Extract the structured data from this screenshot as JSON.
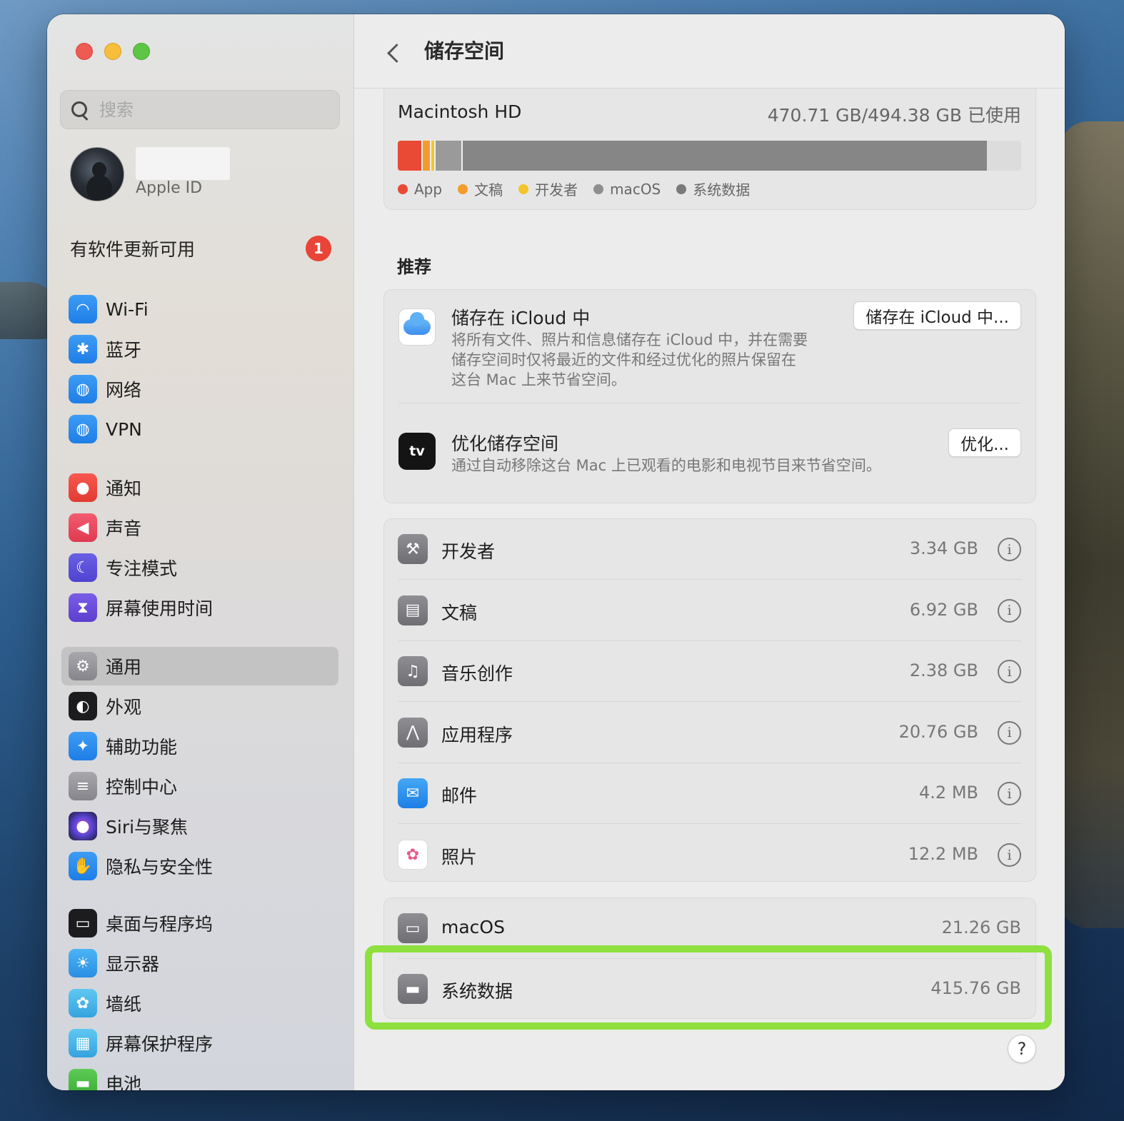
{
  "sidebar": {
    "search_placeholder": "搜索",
    "account": {
      "subtitle": "Apple ID"
    },
    "update": {
      "label": "有软件更新可用",
      "badge": "1"
    },
    "items": [
      {
        "label": "Wi-Fi",
        "icon": "wifi-icon"
      },
      {
        "label": "蓝牙",
        "icon": "bluetooth-icon"
      },
      {
        "label": "网络",
        "icon": "globe-icon"
      },
      {
        "label": "VPN",
        "icon": "vpn-icon"
      },
      {
        "label": "通知",
        "icon": "bell-icon"
      },
      {
        "label": "声音",
        "icon": "speaker-icon"
      },
      {
        "label": "专注模式",
        "icon": "moon-icon"
      },
      {
        "label": "屏幕使用时间",
        "icon": "hourglass-icon"
      },
      {
        "label": "通用",
        "icon": "gear-icon"
      },
      {
        "label": "外观",
        "icon": "appearance-icon"
      },
      {
        "label": "辅助功能",
        "icon": "accessibility-icon"
      },
      {
        "label": "控制中心",
        "icon": "toggles-icon"
      },
      {
        "label": "Siri与聚焦",
        "icon": "siri-icon"
      },
      {
        "label": "隐私与安全性",
        "icon": "hand-icon"
      },
      {
        "label": "桌面与程序坞",
        "icon": "dock-icon"
      },
      {
        "label": "显示器",
        "icon": "sun-icon"
      },
      {
        "label": "墙纸",
        "icon": "flower-icon"
      },
      {
        "label": "屏幕保护程序",
        "icon": "screensaver-icon"
      },
      {
        "label": "电池",
        "icon": "battery-icon"
      }
    ],
    "selected": "通用"
  },
  "header": {
    "title": "储存空间"
  },
  "disk": {
    "name": "Macintosh HD",
    "usage": "470.71 GB/494.38 GB 已使用",
    "bar_segments": [
      {
        "label": "App",
        "fraction": 0.04,
        "color": "#e94a36"
      },
      {
        "label": "文稿",
        "fraction": 0.014,
        "color": "#f39b2b"
      },
      {
        "label": "开发者",
        "fraction": 0.007,
        "color": "#f3c52a"
      },
      {
        "label": "macOS",
        "fraction": 0.043,
        "color": "#9a9a9a"
      },
      {
        "label": "系统数据",
        "fraction": 0.841,
        "color": "#868686"
      }
    ],
    "legend": [
      {
        "label": "App",
        "color": "#e94a36"
      },
      {
        "label": "文稿",
        "color": "#f39b2b"
      },
      {
        "label": "开发者",
        "color": "#f3c52a"
      },
      {
        "label": "macOS",
        "color": "#8e8e8e"
      },
      {
        "label": "系统数据",
        "color": "#7a7a7a"
      }
    ]
  },
  "recommendations": {
    "title": "推荐",
    "icloud": {
      "title": "储存在 iCloud 中",
      "desc": [
        "将所有文件、照片和信息储存在 iCloud 中，并在需要",
        "储存空间时仅将最近的文件和经过优化的照片保留在",
        "这台 Mac 上来节省空间。"
      ],
      "button": "储存在 iCloud 中..."
    },
    "optimize": {
      "title": "优化储存空间",
      "icon_text": "tv",
      "desc": "通过自动移除这台 Mac 上已观看的电影和电视节目来节省空间。",
      "button": "优化..."
    }
  },
  "categories": [
    {
      "label": "开发者",
      "size": "3.34 GB",
      "icon": "hammer-icon"
    },
    {
      "label": "文稿",
      "size": "6.92 GB",
      "icon": "document-icon"
    },
    {
      "label": "音乐创作",
      "size": "2.38 GB",
      "icon": "guitar-icon"
    },
    {
      "label": "应用程序",
      "size": "20.76 GB",
      "icon": "appstore-icon"
    },
    {
      "label": "邮件",
      "size": "4.2 MB",
      "icon": "mail-icon"
    },
    {
      "label": "照片",
      "size": "12.2 MB",
      "icon": "photos-icon"
    }
  ],
  "system": [
    {
      "label": "macOS",
      "size": "21.26 GB",
      "icon": "laptop-icon"
    },
    {
      "label": "系统数据",
      "size": "415.76 GB",
      "icon": "drive-icon"
    }
  ],
  "help_label": "?",
  "info_glyph": "i"
}
